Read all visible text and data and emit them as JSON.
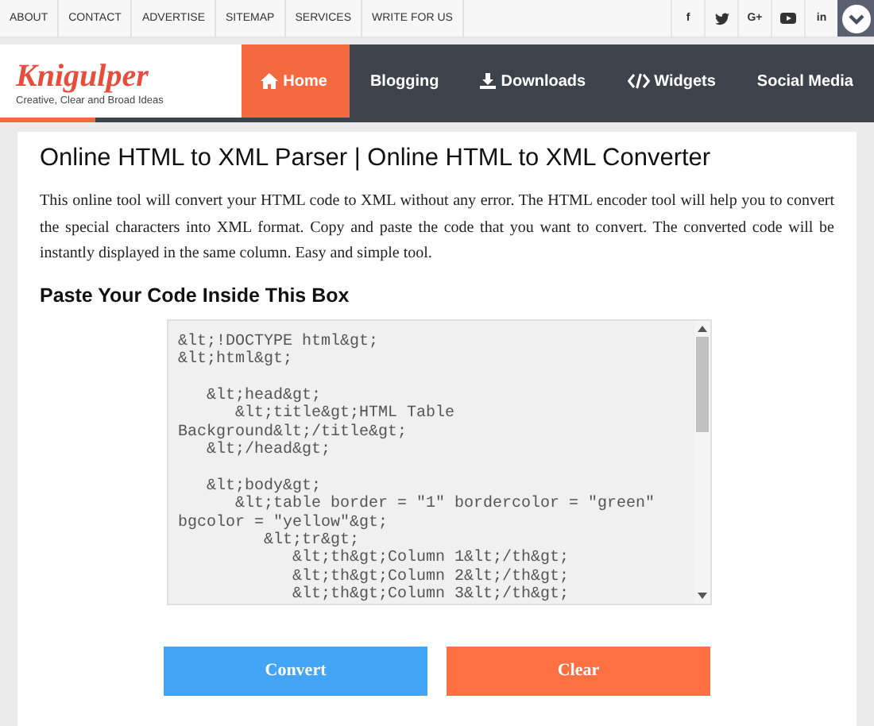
{
  "top_links": [
    "ABOUT",
    "CONTACT",
    "ADVERTISE",
    "SITEMAP",
    "SERVICES",
    "WRITE FOR US"
  ],
  "social": [
    {
      "kind": "letter",
      "label": "f"
    },
    {
      "kind": "bird"
    },
    {
      "kind": "letter",
      "label": "G+"
    },
    {
      "kind": "play"
    },
    {
      "kind": "letter",
      "label": "in"
    }
  ],
  "logo": {
    "name": "Knigulper",
    "tagline": "Creative, Clear and Broad Ideas"
  },
  "nav": [
    {
      "label": "Home",
      "kind": "home",
      "selected": true
    },
    {
      "label": "Blogging",
      "kind": "plain",
      "selected": false
    },
    {
      "label": "Downloads",
      "kind": "download",
      "selected": false
    },
    {
      "label": "Widgets",
      "kind": "code",
      "selected": false
    },
    {
      "label": "Social Media",
      "kind": "plain",
      "selected": false
    }
  ],
  "title": "Online HTML to XML Parser | Online HTML to XML Converter",
  "description": "This online tool will convert your HTML code to XML without any error. The HTML encoder tool will help you to convert the special characters into XML format. Copy and paste the code that you want to convert. The converted code will be instantly displayed in the same column. Easy and simple tool.",
  "subheading": "Paste Your Code Inside This Box",
  "code": "&lt;!DOCTYPE html&gt;\n&lt;html&gt;\n\n   &lt;head&gt;\n      &lt;title&gt;HTML Table Background&lt;/title&gt;\n   &lt;/head&gt;\n\n   &lt;body&gt;\n      &lt;table border = \"1\" bordercolor = \"green\" bgcolor = \"yellow\"&gt;\n         &lt;tr&gt;\n            &lt;th&gt;Column 1&lt;/th&gt;\n            &lt;th&gt;Column 2&lt;/th&gt;\n            &lt;th&gt;Column 3&lt;/th&gt;",
  "buttons": [
    {
      "label": "Convert",
      "kind": "primary"
    },
    {
      "label": "Clear",
      "kind": "danger"
    }
  ]
}
